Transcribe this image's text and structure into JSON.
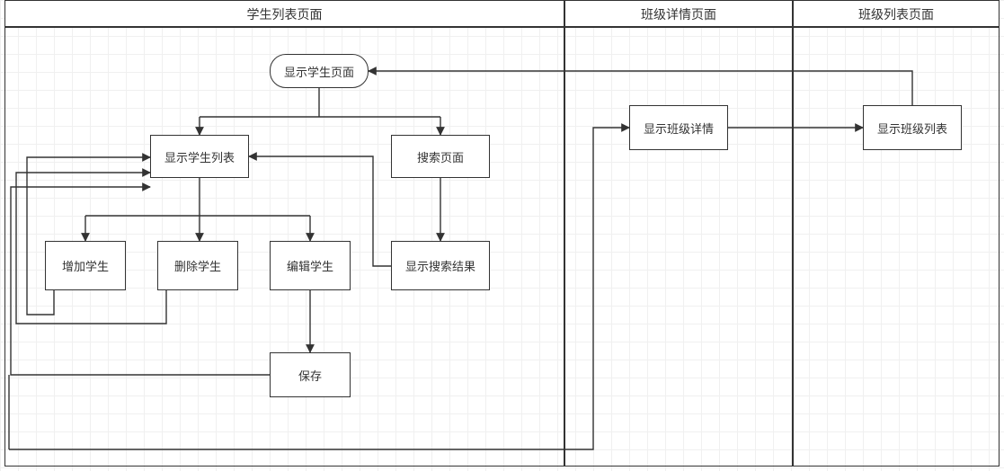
{
  "lanes": {
    "student": "学生列表页面",
    "classDetail": "班级详情页面",
    "classList": "班级列表页面"
  },
  "nodes": {
    "showStudentPage": "显示学生页面",
    "showStudentList": "显示学生列表",
    "searchPage": "搜索页面",
    "addStudent": "增加学生",
    "deleteStudent": "删除学生",
    "editStudent": "编辑学生",
    "showSearchResult": "显示搜索结果",
    "save": "保存",
    "showClassDetail": "显示班级详情",
    "showClassList": "显示班级列表"
  }
}
